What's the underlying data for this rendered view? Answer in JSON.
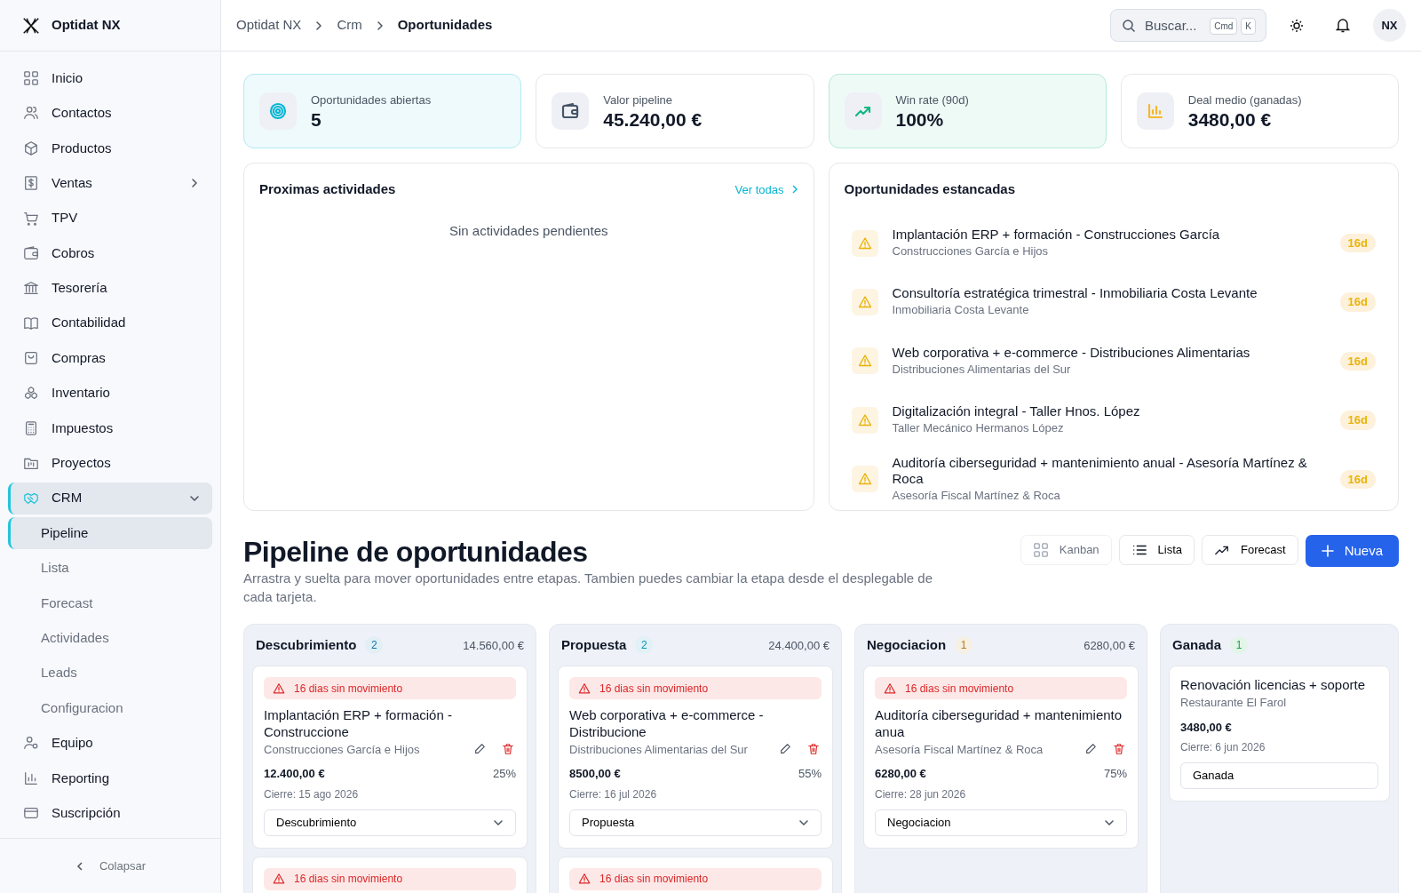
{
  "app": {
    "name": "Optidat NX"
  },
  "sidebar": {
    "items": [
      {
        "label": "Inicio",
        "selected": false
      },
      {
        "label": "Contactos",
        "selected": false
      },
      {
        "label": "Productos",
        "selected": false
      },
      {
        "label": "Ventas",
        "selected": false,
        "expanded": false
      },
      {
        "label": "TPV",
        "selected": false
      },
      {
        "label": "Cobros",
        "selected": false
      },
      {
        "label": "Tesorería",
        "selected": false
      },
      {
        "label": "Contabilidad",
        "selected": false
      },
      {
        "label": "Compras",
        "selected": false
      },
      {
        "label": "Inventario",
        "selected": false
      },
      {
        "label": "Impuestos",
        "selected": false
      },
      {
        "label": "Proyectos",
        "selected": false
      },
      {
        "label": "CRM",
        "selected": true,
        "expanded": true,
        "children": [
          {
            "label": "Pipeline",
            "selected": true
          },
          {
            "label": "Lista",
            "selected": false
          },
          {
            "label": "Forecast",
            "selected": false
          },
          {
            "label": "Actividades",
            "selected": false
          },
          {
            "label": "Leads",
            "selected": false
          },
          {
            "label": "Configuracion",
            "selected": false
          }
        ]
      },
      {
        "label": "Equipo",
        "selected": false
      },
      {
        "label": "Reporting",
        "selected": false
      },
      {
        "label": "Suscripción",
        "selected": false
      }
    ],
    "collapse": "Colapsar"
  },
  "breadcrumb": [
    "Optidat NX",
    "Crm",
    "Oportunidades"
  ],
  "search": {
    "placeholder": "Buscar...",
    "shortcut": [
      "Cmd",
      "K"
    ]
  },
  "avatar": "NX",
  "stats": [
    {
      "label": "Oportunidades abiertas",
      "value": "5",
      "color": "#06b6d4"
    },
    {
      "label": "Valor pipeline",
      "value": "45.240,00 €",
      "color": "#475569"
    },
    {
      "label": "Win rate (90d)",
      "value": "100%",
      "color": "#10b981"
    },
    {
      "label": "Deal medio (ganadas)",
      "value": "3480,00 €",
      "color": "#f5b82e"
    }
  ],
  "activities": {
    "title": "Proximas actividades",
    "link": "Ver todas",
    "empty": "Sin actividades pendientes"
  },
  "stalled": {
    "title": "Oportunidades estancadas",
    "items": [
      {
        "title": "Implantación ERP + formación - Construcciones García",
        "company": "Construcciones García e Hijos",
        "days": "16d"
      },
      {
        "title": "Consultoría estratégica trimestral - Inmobiliaria Costa Levante",
        "company": "Inmobiliaria Costa Levante",
        "days": "16d"
      },
      {
        "title": "Web corporativa + e-commerce - Distribuciones Alimentarias",
        "company": "Distribuciones Alimentarias del Sur",
        "days": "16d"
      },
      {
        "title": "Digitalización integral - Taller Hnos. López",
        "company": "Taller Mecánico Hermanos López",
        "days": "16d"
      },
      {
        "title": "Auditoría ciberseguridad + mantenimiento anual - Asesoría Martínez & Roca",
        "company": "Asesoría Fiscal Martínez & Roca",
        "days": "16d"
      }
    ]
  },
  "pipeline": {
    "title": "Pipeline de oportunidades",
    "description": "Arrastra y suelta para mover oportunidades entre etapas. Tambien puedes cambiar la etapa desde el desplegable de cada tarjeta.",
    "views": [
      {
        "label": "Kanban",
        "selected": true
      },
      {
        "label": "Lista",
        "selected": false
      },
      {
        "label": "Forecast",
        "selected": false
      }
    ],
    "new_button": "Nueva"
  },
  "stages": [
    {
      "name": "Descubrimiento",
      "count": "2",
      "total": "14.560,00 €",
      "color": "#0e7aa8",
      "cards": [
        {
          "alert": "16 dias sin movimiento",
          "title": "Implantación ERP + formación - Construccione",
          "company": "Construcciones García e Hijos",
          "amount": "12.400,00 €",
          "probability": "25%",
          "close": "Cierre: 15 ago 2026",
          "stage": "Descubrimiento"
        },
        {
          "alert": "16 dias sin movimiento"
        }
      ]
    },
    {
      "name": "Propuesta",
      "count": "2",
      "total": "24.400,00 €",
      "color": "#0891b2",
      "cards": [
        {
          "alert": "16 dias sin movimiento",
          "title": "Web corporativa + e-commerce - Distribucione",
          "company": "Distribuciones Alimentarias del Sur",
          "amount": "8500,00 €",
          "probability": "55%",
          "close": "Cierre: 16 jul 2026",
          "stage": "Propuesta"
        },
        {
          "alert": "16 dias sin movimiento"
        }
      ]
    },
    {
      "name": "Negociacion",
      "count": "1",
      "total": "6280,00 €",
      "color": "#b7791f",
      "cards": [
        {
          "alert": "16 dias sin movimiento",
          "title": "Auditoría ciberseguridad + mantenimiento anua",
          "company": "Asesoría Fiscal Martínez & Roca",
          "amount": "6280,00 €",
          "probability": "75%",
          "close": "Cierre: 28 jun 2026",
          "stage": "Negociacion"
        }
      ]
    },
    {
      "name": "Ganada",
      "count": "1",
      "color": "#16a34a",
      "cards": [
        {
          "title": "Renovación licencias + soporte",
          "company": "Restaurante El Farol",
          "amount": "3480,00 €",
          "close": "Cierre: 6 jun 2026",
          "stage": "Ganada"
        }
      ]
    }
  ]
}
